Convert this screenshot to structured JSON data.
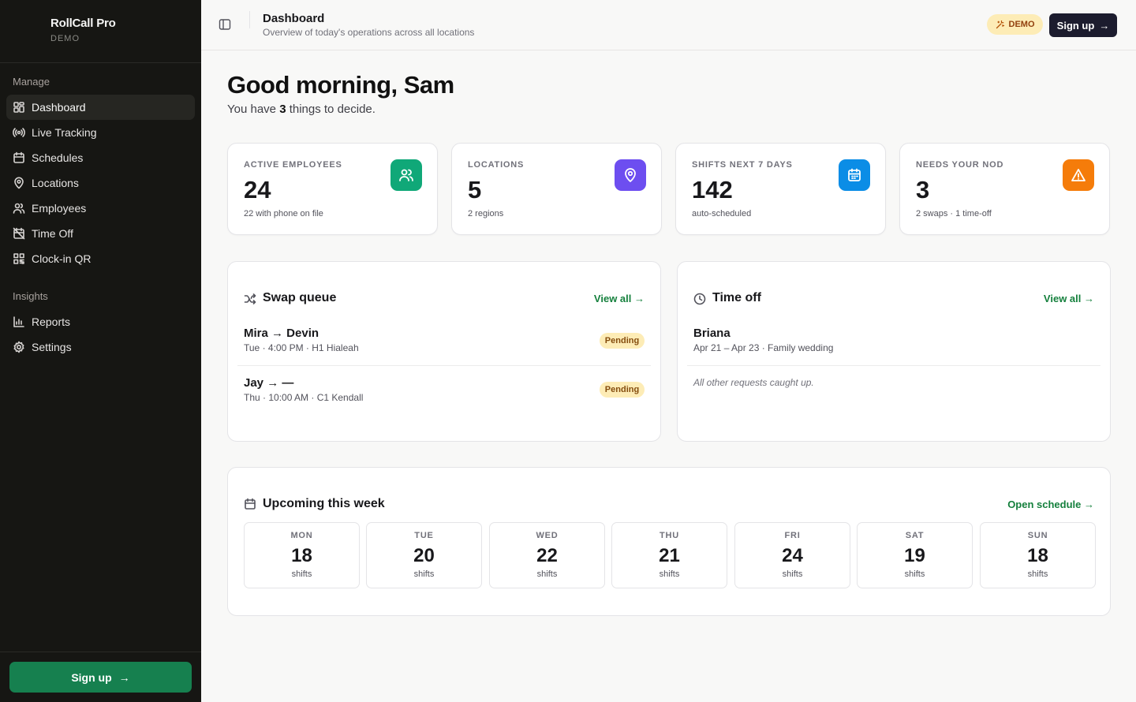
{
  "brand": {
    "name": "RollCall Pro",
    "tag": "DEMO"
  },
  "nav": {
    "section_manage": "Manage",
    "section_insights": "Insights",
    "items": [
      {
        "label": "Dashboard",
        "icon": "dashboard-icon"
      },
      {
        "label": "Live Tracking",
        "icon": "broadcast-icon"
      },
      {
        "label": "Schedules",
        "icon": "calendar-icon"
      },
      {
        "label": "Locations",
        "icon": "map-pin-icon"
      },
      {
        "label": "Employees",
        "icon": "users-icon"
      },
      {
        "label": "Time Off",
        "icon": "calendar-off-icon"
      },
      {
        "label": "Clock-in QR",
        "icon": "qr-code-icon"
      },
      {
        "label": "Reports",
        "icon": "bar-chart-icon"
      },
      {
        "label": "Settings",
        "icon": "gear-icon"
      }
    ],
    "signup_label": "Sign up"
  },
  "header": {
    "title": "Dashboard",
    "subtitle": "Overview of today's operations across all locations",
    "demo_badge": "DEMO",
    "signup_label": "Sign up"
  },
  "greeting": {
    "title": "Good morning, Sam",
    "prefix": "You have ",
    "count": "3",
    "suffix": " things to decide."
  },
  "stats": [
    {
      "label": "ACTIVE EMPLOYEES",
      "value": "24",
      "sub": "22 with phone on file",
      "color": "#10a878",
      "icon": "users-icon"
    },
    {
      "label": "LOCATIONS",
      "value": "5",
      "sub": "2 regions",
      "color": "#6d4ef0",
      "icon": "map-pin-icon"
    },
    {
      "label": "SHIFTS NEXT 7 DAYS",
      "value": "142",
      "sub": "auto-scheduled",
      "color": "#0b8de6",
      "icon": "calendar-icon"
    },
    {
      "label": "NEEDS YOUR NOD",
      "value": "3",
      "sub": "2 swaps · 1 time-off",
      "color": "#f57c0a",
      "icon": "warning-icon"
    }
  ],
  "swap_queue": {
    "title": "Swap queue",
    "link": "View all →",
    "rows": [
      {
        "main": "Mira → Devin",
        "sub": "Tue · 4:00 PM · H1 Hialeah",
        "status": "Pending"
      },
      {
        "main": "Jay → —",
        "sub": "Thu · 10:00 AM · C1 Kendall",
        "status": "Pending"
      }
    ]
  },
  "time_off": {
    "title": "Time off",
    "link": "View all →",
    "rows": [
      {
        "main": "Briana",
        "sub": "Apr 21 – Apr 23 · Family wedding"
      }
    ],
    "note": "All other requests caught up."
  },
  "week": {
    "title": "Upcoming this week",
    "link": "Open schedule →",
    "days": [
      {
        "day": "MON",
        "count": "18",
        "unit": "shifts"
      },
      {
        "day": "TUE",
        "count": "20",
        "unit": "shifts"
      },
      {
        "day": "WED",
        "count": "22",
        "unit": "shifts"
      },
      {
        "day": "THU",
        "count": "21",
        "unit": "shifts"
      },
      {
        "day": "FRI",
        "count": "24",
        "unit": "shifts"
      },
      {
        "day": "SAT",
        "count": "19",
        "unit": "shifts"
      },
      {
        "day": "SUN",
        "count": "18",
        "unit": "shifts"
      }
    ]
  }
}
